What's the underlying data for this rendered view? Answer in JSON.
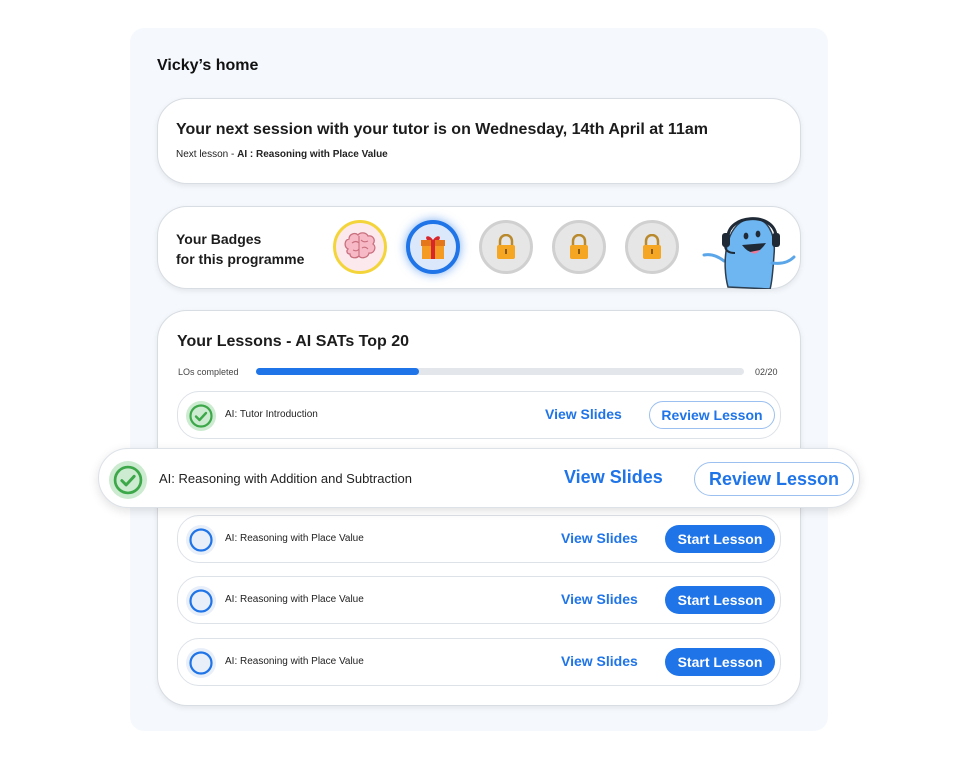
{
  "home": {
    "title": "Vicky’s home"
  },
  "session": {
    "title": "Your next session with your tutor is on Wednesday, 14th April at 11am",
    "next_prefix": "Next lesson - ",
    "next_lesson": "AI : Reasoning with Place Value"
  },
  "badges": {
    "label_line1": "Your Badges",
    "label_line2": "for this programme",
    "items": [
      {
        "icon": "brain-icon",
        "state": "earned"
      },
      {
        "icon": "gift-icon",
        "state": "selected"
      },
      {
        "icon": "lock-icon",
        "state": "locked"
      },
      {
        "icon": "lock-icon",
        "state": "locked"
      },
      {
        "icon": "lock-icon",
        "state": "locked"
      }
    ]
  },
  "lessons": {
    "title": "Your Lessons - AI SATs Top 20",
    "progress_label": "LOs completed",
    "progress_count": "02/20",
    "progress_fraction": 0.333,
    "items": [
      {
        "name": "AI: Tutor Introduction",
        "view_label": "View Slides",
        "action_label": "Review Lesson",
        "status": "completed"
      },
      {
        "name": "AI: Reasoning with Addition and Subtraction",
        "view_label": "View Slides",
        "action_label": "Review Lesson",
        "status": "completed"
      },
      {
        "name": "AI: Reasoning with Place Value",
        "view_label": "View Slides",
        "action_label": "Start Lesson",
        "status": "not-started"
      },
      {
        "name": "AI: Reasoning with Place Value",
        "view_label": "View Slides",
        "action_label": "Start Lesson",
        "status": "not-started"
      },
      {
        "name": "AI: Reasoning with Place Value",
        "view_label": "View Slides",
        "action_label": "Start Lesson",
        "status": "not-started"
      }
    ]
  },
  "colors": {
    "accent": "#1f74e8",
    "success": "#3da84a",
    "panel": "#f5f9fd"
  }
}
